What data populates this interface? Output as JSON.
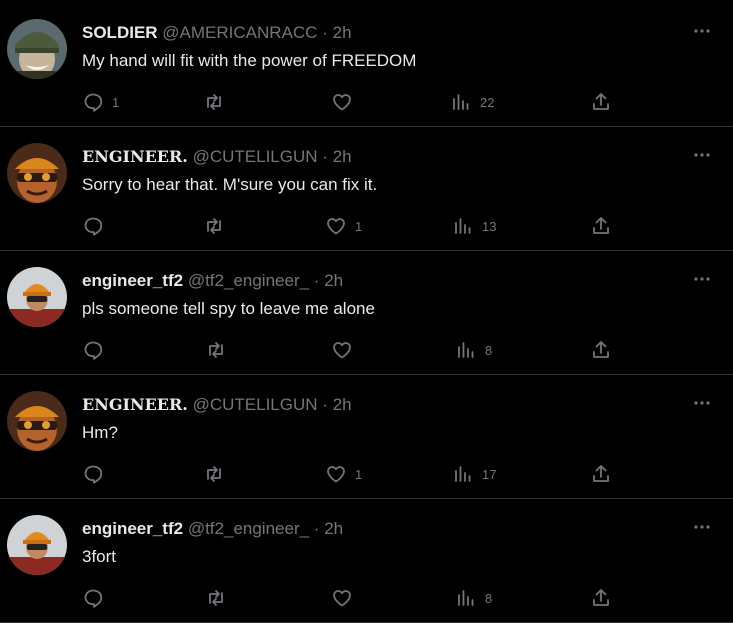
{
  "colors": {
    "background": "#000000",
    "text": "#e7e9ea",
    "muted": "#71767b",
    "divider": "#2f3336"
  },
  "tweets": [
    {
      "name": "SOLDIER",
      "handle": "@AMERICANRACC",
      "time": "2h",
      "text": "My hand will fit with the power of FREEDOM",
      "avatar": "soldier-avatar",
      "replies": "1",
      "reposts": "",
      "likes": "",
      "views": "22"
    },
    {
      "name": "ENGINEER.",
      "handle": "@CUTELILGUN",
      "time": "2h",
      "text": "Sorry to hear that. M'sure you can fix it.",
      "avatar": "engineer-avatar",
      "replies": "",
      "reposts": "",
      "likes": "1",
      "views": "13"
    },
    {
      "name": "engineer_tf2",
      "handle": "@tf2_engineer_",
      "time": "2h",
      "text": "pls someone tell spy to leave me alone",
      "avatar": "engineer-tf2-avatar",
      "replies": "",
      "reposts": "",
      "likes": "",
      "views": "8"
    },
    {
      "name": "ENGINEER.",
      "handle": "@CUTELILGUN",
      "time": "2h",
      "text": "Hm?",
      "avatar": "engineer-avatar",
      "replies": "",
      "reposts": "",
      "likes": "1",
      "views": "17"
    },
    {
      "name": "engineer_tf2",
      "handle": "@tf2_engineer_",
      "time": "2h",
      "text": "3fort",
      "avatar": "engineer-tf2-avatar",
      "replies": "",
      "reposts": "",
      "likes": "",
      "views": "8"
    }
  ],
  "separator": "·",
  "icons": {
    "reply": "reply-icon",
    "repost": "repost-icon",
    "like": "heart-icon",
    "views": "views-icon",
    "share": "share-icon",
    "more": "more-icon"
  }
}
